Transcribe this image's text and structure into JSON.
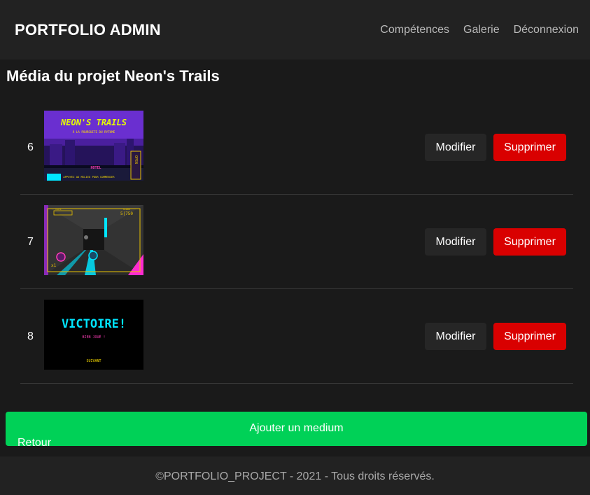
{
  "navbar": {
    "brand": "PORTFOLIO ADMIN",
    "links": [
      "Compétences",
      "Galerie",
      "Déconnexion"
    ]
  },
  "page_title": "Média du projet Neon's Trails",
  "media": [
    {
      "id": "6",
      "thumbnail": {
        "title": "NEON'S TRAILS",
        "subtitle": "À LA POURSUITE DU RYTHME",
        "sign": "HOTEL",
        "open_sign": "OPEN",
        "prompt": "APPUYEZ AU MILIEU POUR COMMENCER"
      }
    },
    {
      "id": "7",
      "thumbnail": {
        "hud_left": "VIES",
        "hud_score_label": "SCORE",
        "hud_score": "5|750",
        "multiplier": "x1"
      }
    },
    {
      "id": "8",
      "thumbnail": {
        "title": "VICTOIRE!",
        "subtitle": "BIEN JOUÉ !",
        "next": "SUIVANT"
      }
    }
  ],
  "buttons": {
    "edit": "Modifier",
    "delete": "Supprimer",
    "add": "Ajouter un medium",
    "back": "Retour"
  },
  "footer": "©PORTFOLIO_PROJECT - 2021 - Tous droits réservés.",
  "colors": {
    "background": "#1a1a1a",
    "navbar": "#222222",
    "delete": "#d90000",
    "add": "#00d157"
  }
}
